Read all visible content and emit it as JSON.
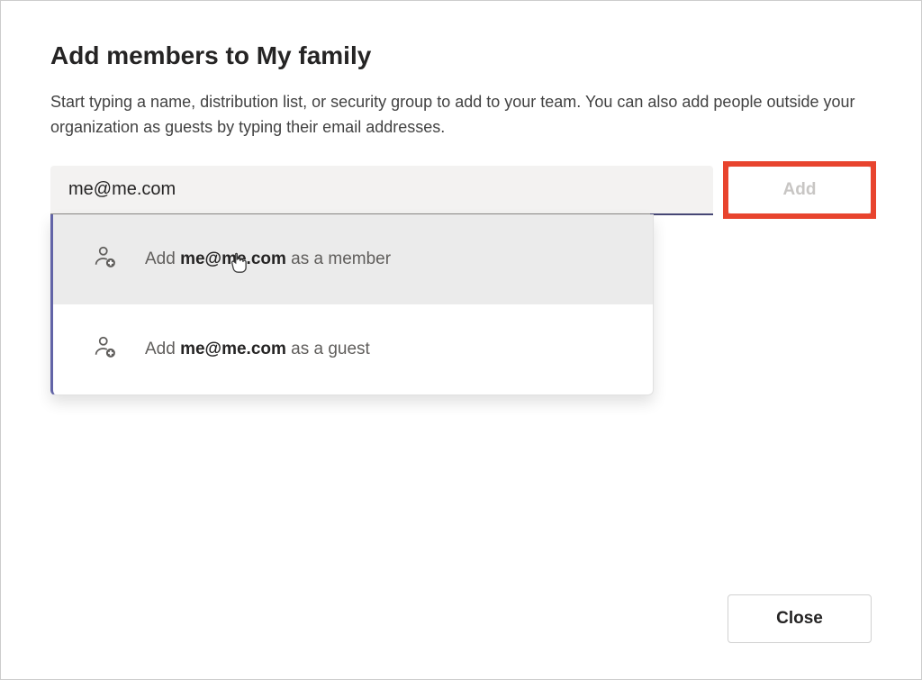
{
  "dialog": {
    "title": "Add members to My family",
    "description": "Start typing a name, distribution list, or security group to add to your team. You can also add people outside your organization as guests by typing their email addresses.",
    "input_value": "me@me.com",
    "add_button_label": "Add",
    "close_button_label": "Close"
  },
  "suggestions": [
    {
      "prefix": "Add ",
      "bold": "me@me.com",
      "suffix": " as a member",
      "role": "member",
      "hovered": true
    },
    {
      "prefix": "Add ",
      "bold": "me@me.com",
      "suffix": " as a guest",
      "role": "guest",
      "hovered": false
    }
  ]
}
